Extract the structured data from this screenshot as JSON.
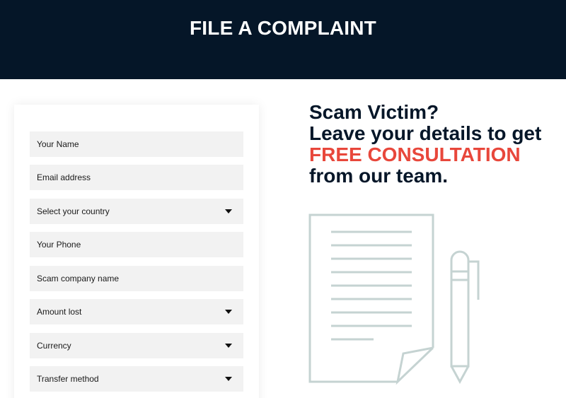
{
  "header": {
    "title": "FILE A COMPLAINT"
  },
  "form": {
    "name_placeholder": "Your Name",
    "email_placeholder": "Email address",
    "country_label": "Select your country",
    "phone_placeholder": "Your Phone",
    "company_placeholder": "Scam company name",
    "amount_label": "Amount lost",
    "currency_label": "Currency",
    "transfer_label": "Transfer method"
  },
  "promo": {
    "line1": "Scam Victim?",
    "line2": "Leave your details to get",
    "accent": "FREE CONSULTATION",
    "line4": "from our team."
  },
  "colors": {
    "header_bg": "#051628",
    "accent": "#e8473b",
    "field_bg": "#f2f2f2",
    "illustration_stroke": "#c5d3d2"
  },
  "icons": {
    "document": "document-icon",
    "pen": "pen-icon",
    "dropdown": "chevron-down-icon"
  }
}
